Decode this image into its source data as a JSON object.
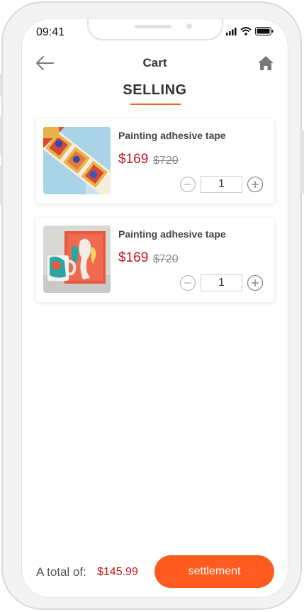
{
  "status_bar": {
    "time": "09:41"
  },
  "header": {
    "title": "Cart"
  },
  "section": {
    "title": "SELLING"
  },
  "products": [
    {
      "name": "Painting adhesive tape",
      "price": "$169",
      "original_price": "$720",
      "quantity": "1",
      "image": "tape-roll-image"
    },
    {
      "name": "Painting adhesive tape",
      "price": "$169",
      "original_price": "$720",
      "quantity": "1",
      "image": "mug-and-canvas-image"
    }
  ],
  "footer": {
    "total_label": "A total of:",
    "total_value": "$145.99",
    "settlement_label": "settlement"
  },
  "colors": {
    "accent": "#ff5a1f",
    "price": "#c0181b"
  }
}
